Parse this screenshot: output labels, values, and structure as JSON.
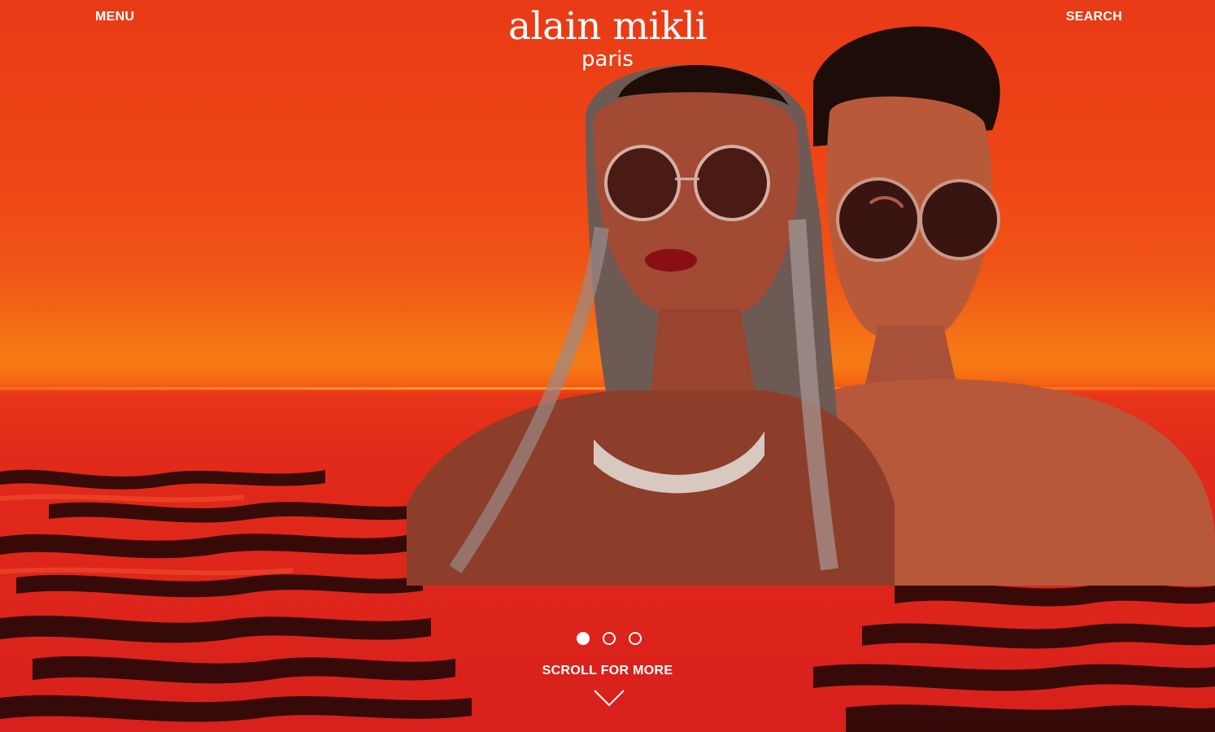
{
  "header": {
    "menu_label": "MENU",
    "search_label": "SEARCH",
    "logo_main": "alain mikli",
    "logo_sub": "paris"
  },
  "carousel": {
    "slide_count": 3,
    "active_index": 0
  },
  "scroll_prompt": "SCROLL FOR MORE",
  "icons": {
    "scroll": "chevron-down-icon"
  },
  "colors": {
    "sky": "#ef4717",
    "water": "#d8201c",
    "text": "#ffffff"
  }
}
